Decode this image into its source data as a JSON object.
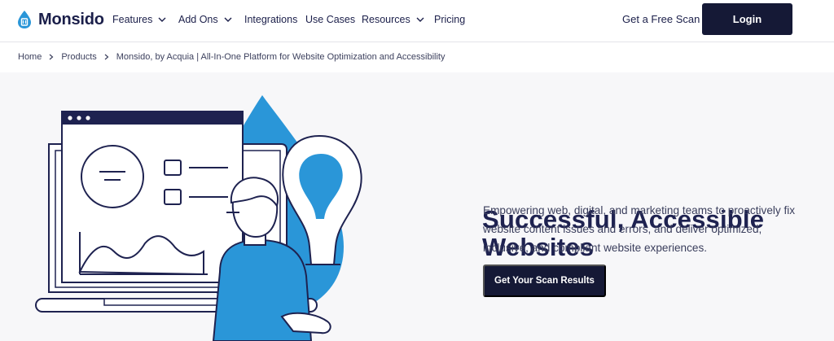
{
  "brand": {
    "name": "Monsido"
  },
  "nav": {
    "items": [
      {
        "label": "Features",
        "has_dropdown": true
      },
      {
        "label": "Add Ons",
        "has_dropdown": true
      },
      {
        "label": "Integrations",
        "has_dropdown": false
      },
      {
        "label": "Use Cases",
        "has_dropdown": false
      },
      {
        "label": "Resources",
        "has_dropdown": true
      },
      {
        "label": "Pricing",
        "has_dropdown": false
      }
    ],
    "free_scan_label": "Get a Free Scan",
    "login_label": "Login"
  },
  "breadcrumb": {
    "items": [
      "Home",
      "Products",
      "Monsido, by Acquia | All-In-One Platform for Website Optimization and Accessibility"
    ]
  },
  "hero": {
    "title_line1": "Successful, Accessible",
    "title_line2": "Websites",
    "description": "Empowering web, digital, and marketing teams to proactively fix website content issues and errors, and deliver optimized, inclusive, and compliant website experiences.",
    "cta_label": "Get Your Scan Results"
  },
  "colors": {
    "brand_dark": "#151936",
    "text_dark": "#1e2250",
    "accent_blue": "#2a96d8",
    "hero_bg": "#f7f7f9"
  },
  "icons": [
    "droplet-logo-icon",
    "chevron-down-icon",
    "chevron-right-icon"
  ]
}
